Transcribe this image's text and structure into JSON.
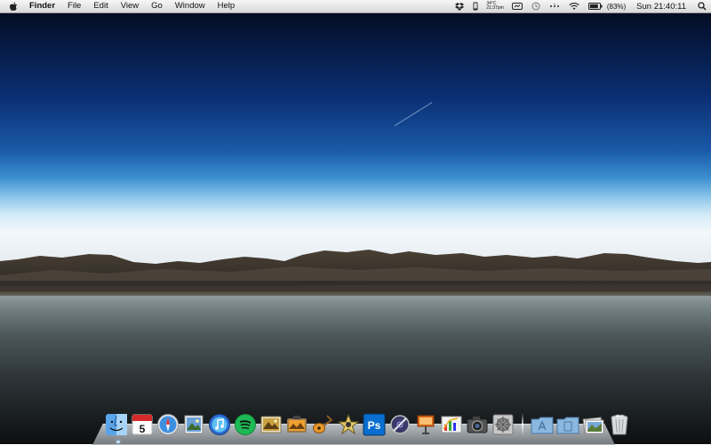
{
  "menubar": {
    "app_name": "Finder",
    "menus": [
      "File",
      "Edit",
      "View",
      "Go",
      "Window",
      "Help"
    ],
    "status": {
      "weather_temp": "34°C",
      "weather_time": "21:37pm",
      "battery_percent": "(83%)",
      "clock": "Sun 21:40:11"
    }
  },
  "dock": {
    "items": [
      {
        "name": "Finder",
        "icon": "finder-icon"
      },
      {
        "name": "iCal",
        "icon": "calendar-icon",
        "label": "5"
      },
      {
        "name": "Safari",
        "icon": "safari-icon"
      },
      {
        "name": "Preview",
        "icon": "preview-icon"
      },
      {
        "name": "iTunes",
        "icon": "itunes-icon"
      },
      {
        "name": "Spotify",
        "icon": "spotify-icon"
      },
      {
        "name": "iPhoto",
        "icon": "iphoto-icon"
      },
      {
        "name": "Photo Booth",
        "icon": "photo-icon"
      },
      {
        "name": "GarageBand",
        "icon": "guitar-icon"
      },
      {
        "name": "iMovie",
        "icon": "imovie-star-icon"
      },
      {
        "name": "Photoshop",
        "icon": "photoshop-icon",
        "label": "Ps"
      },
      {
        "name": "Instruments",
        "icon": "instruments-icon"
      },
      {
        "name": "Keynote",
        "icon": "keynote-icon"
      },
      {
        "name": "Grapher",
        "icon": "chart-icon"
      },
      {
        "name": "Camera",
        "icon": "camera-icon"
      },
      {
        "name": "System Preferences",
        "icon": "system-preferences-icon"
      },
      {
        "name": "Applications",
        "icon": "applications-folder-icon"
      },
      {
        "name": "Documents",
        "icon": "documents-folder-icon"
      },
      {
        "name": "Downloads",
        "icon": "downloads-stack-icon"
      },
      {
        "name": "Trash",
        "icon": "trash-icon"
      }
    ]
  },
  "colors": {
    "sky_top": "#020815",
    "sky_mid": "#1a5aa8",
    "horizon": "#f2f8fb",
    "lake": "#4c575b",
    "spotify_green": "#1db954",
    "photoshop_blue": "#0a6ed1"
  }
}
